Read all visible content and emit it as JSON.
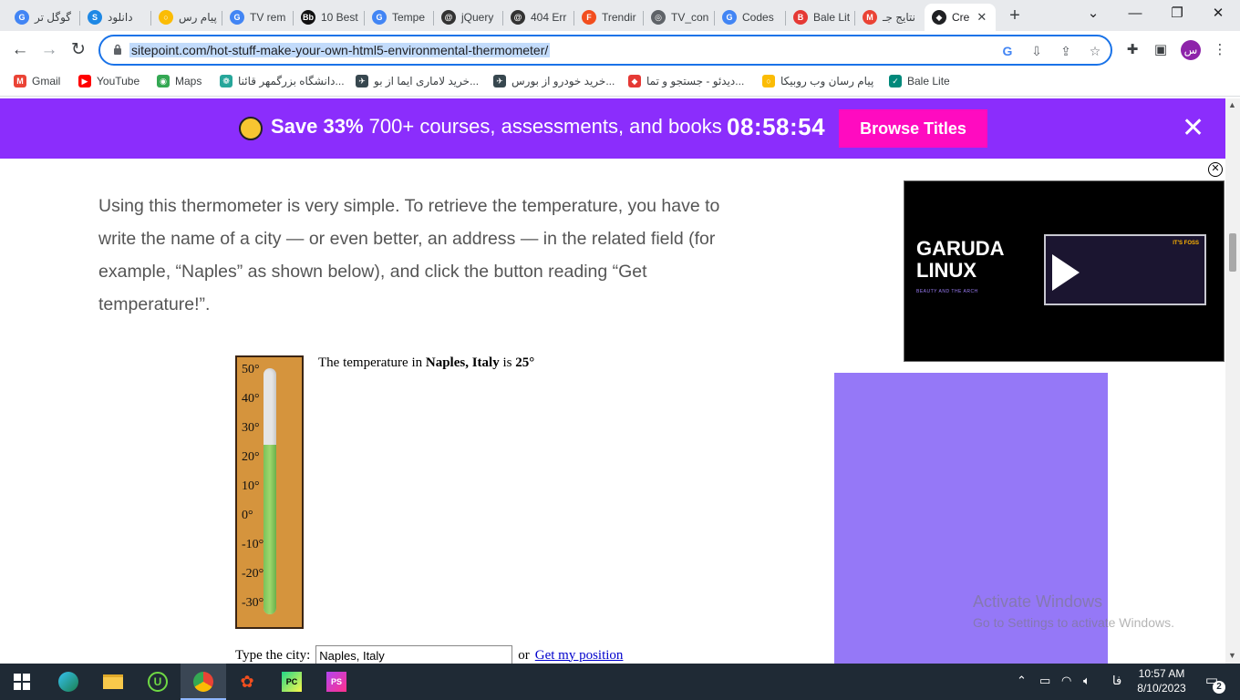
{
  "tabs": [
    {
      "label": "گوگل تر",
      "fav_color": "#4285f4",
      "fav_glyph": "G"
    },
    {
      "label": "دانلود",
      "fav_color": "#1e88e5",
      "fav_glyph": "S"
    },
    {
      "label": "پیام رس",
      "fav_color": "#fbbc05",
      "fav_glyph": "○"
    },
    {
      "label": "TV rem",
      "fav_color": "#4285f4",
      "fav_glyph": "G"
    },
    {
      "label": "10 Best",
      "fav_color": "#111111",
      "fav_glyph": "Bb"
    },
    {
      "label": "Tempe",
      "fav_color": "#4285f4",
      "fav_glyph": "G"
    },
    {
      "label": "jQuery",
      "fav_color": "#333333",
      "fav_glyph": "@"
    },
    {
      "label": "404 Err",
      "fav_color": "#333333",
      "fav_glyph": "@"
    },
    {
      "label": "Trendir",
      "fav_color": "#f24e1e",
      "fav_glyph": "F"
    },
    {
      "label": "TV_con",
      "fav_color": "#5f6368",
      "fav_glyph": "◎"
    },
    {
      "label": "Codes",
      "fav_color": "#4285f4",
      "fav_glyph": "G"
    },
    {
      "label": "Bale Lit",
      "fav_color": "#e53935",
      "fav_glyph": "B"
    },
    {
      "label": "نتایج جـ",
      "fav_color": "#ea4335",
      "fav_glyph": "M"
    },
    {
      "label": "Cre",
      "fav_color": "#202124",
      "fav_glyph": "◆"
    }
  ],
  "address": {
    "url": "sitepoint.com/hot-stuff-make-your-own-html5-environmental-thermometer/"
  },
  "bookmarks": [
    {
      "label": "Gmail",
      "color": "#ea4335",
      "glyph": "M"
    },
    {
      "label": "YouTube",
      "color": "#ff0000",
      "glyph": "▶"
    },
    {
      "label": "Maps",
      "color": "#34a853",
      "glyph": "◉"
    },
    {
      "label": "دانشگاه بزرگمهر قائنا...",
      "color": "#26a69a",
      "glyph": "❁"
    },
    {
      "label": "خرید لاماری ایما از بو...",
      "color": "#37474f",
      "glyph": "✈"
    },
    {
      "label": "خرید خودرو از بورس...",
      "color": "#37474f",
      "glyph": "✈"
    },
    {
      "label": "دیدئو - جستجو و تما...",
      "color": "#e53935",
      "glyph": "◆"
    },
    {
      "label": "پیام رسان وب روبیکا",
      "color": "#fbbc05",
      "glyph": "○"
    },
    {
      "label": "Bale Lite",
      "color": "#00897b",
      "glyph": "✓"
    }
  ],
  "promo": {
    "save": "Save 33%",
    "text": "700+ courses, assessments, and books",
    "timer": "08:58:54",
    "button": "Browse Titles",
    "close": "✕"
  },
  "article": {
    "paragraph": "Using this thermometer is very simple. To retrieve the temperature, you have to write the name of a city — or even better, an address — in the related field (for example, “Naples” as shown below), and click the button reading “Get temperature!”."
  },
  "thermometer": {
    "temperature": 25,
    "min": -30,
    "max": 50,
    "ticks": [
      "50°",
      "40°",
      "30°",
      "20°",
      "10°",
      "0°",
      "-10°",
      "-20°",
      "-30°"
    ],
    "prefix": "The temperature in ",
    "city": "Naples, Italy",
    "mid": " is ",
    "value_text": "25°",
    "fill_color": "#8fd16a",
    "frame_color": "#d5943d"
  },
  "city_form": {
    "label": "Type the city:",
    "value": "Naples, Italy",
    "or": "or",
    "link": "Get my position"
  },
  "video": {
    "title": "GARUDA LINUX",
    "tagline": "BEAUTY AND THE ARCH",
    "screen_label": "IT'S FOSS"
  },
  "watermark": {
    "line1": "Activate Windows",
    "line2": "Go to Settings to activate Windows."
  },
  "taskbar": {
    "time": "10:57 AM",
    "date": "8/10/2023",
    "lang": "فا",
    "notifications": "2"
  }
}
